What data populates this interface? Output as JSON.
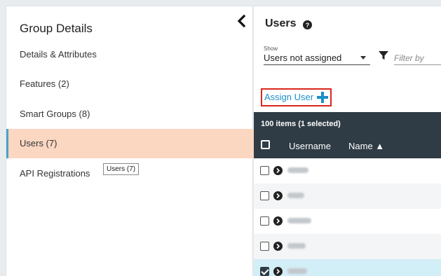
{
  "sidebar": {
    "title": "Group Details",
    "items": [
      {
        "label": "Details & Attributes",
        "active": false
      },
      {
        "label": "Features (2)",
        "active": false
      },
      {
        "label": "Smart Groups (8)",
        "active": false
      },
      {
        "label": "Users (7)",
        "active": true
      },
      {
        "label": "API Registrations",
        "active": false
      }
    ],
    "tooltip": "Users (7)"
  },
  "main": {
    "title": "Users",
    "show_label": "Show",
    "show_value": "Users not assigned",
    "filter_placeholder": "Filter by",
    "assign_label": "Assign User",
    "table": {
      "item_count": "100 items (1 selected)",
      "columns": [
        "Username",
        "Name ▲"
      ],
      "rows": [
        {
          "checked": false
        },
        {
          "checked": false
        },
        {
          "checked": false
        },
        {
          "checked": false
        },
        {
          "checked": true
        }
      ]
    }
  },
  "colors": {
    "active_bg": "#fbd7c2",
    "active_bar": "#4aa3c8",
    "header_bg": "#2f3c46",
    "assign_border": "#d9261c",
    "link": "#1a8fc7",
    "plus": "#1a8fc7",
    "selected_row": "#d2eef6"
  },
  "icons": [
    "chevron-left-icon",
    "help-icon",
    "caret-down-icon",
    "filter-icon",
    "plus-icon",
    "expand-icon"
  ]
}
